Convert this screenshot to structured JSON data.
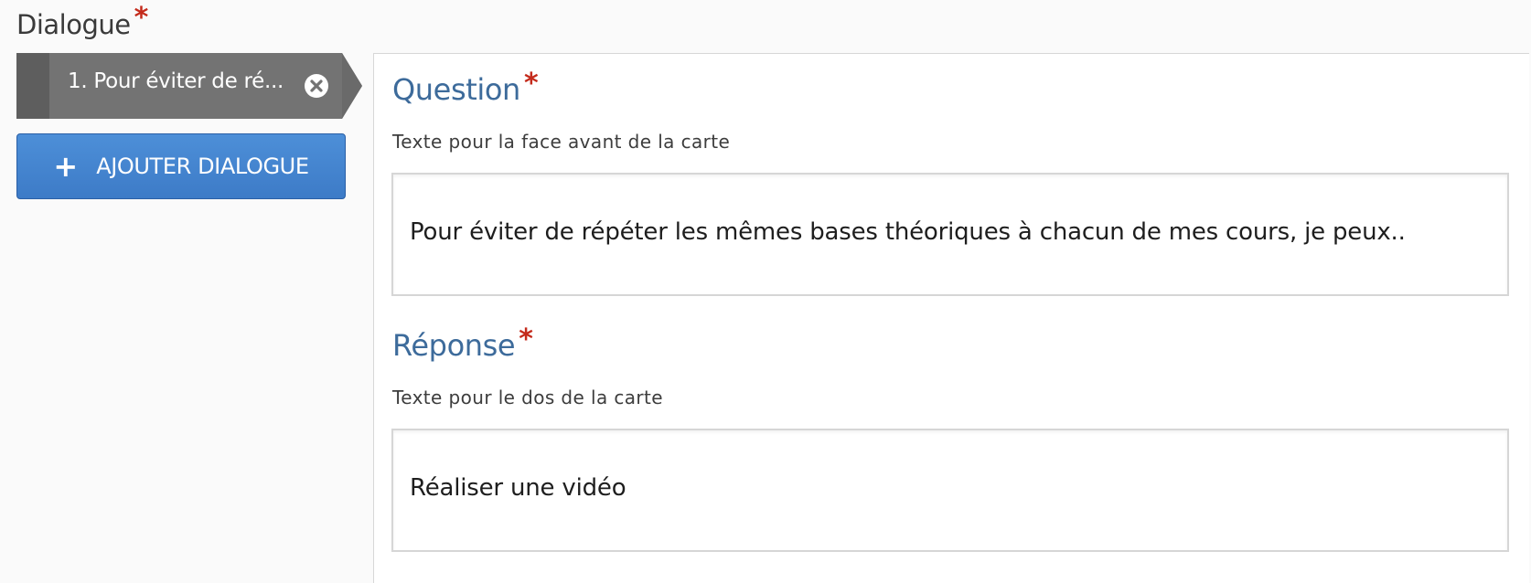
{
  "section": {
    "label": "Dialogue",
    "required_mark": "*"
  },
  "dialogue_list": {
    "items": [
      {
        "label": "1. Pour éviter de ré..."
      }
    ],
    "add_button_label": "AJOUTER DIALOGUE"
  },
  "question": {
    "title": "Question",
    "required_mark": "*",
    "description": "Texte pour la face avant de la carte",
    "value": "Pour éviter de répéter les mêmes bases théoriques à chacun de mes cours, je peux.."
  },
  "answer": {
    "title": "Réponse",
    "required_mark": "*",
    "description": "Texte pour le dos de la carte",
    "value": "Réaliser une vidéo"
  },
  "icons": {
    "tab_close": "close-circle-icon",
    "add": "plus-icon"
  },
  "colors": {
    "tab_bg": "#737373",
    "tab_handle": "#5e5e5e",
    "button_blue": "#3d7bc7",
    "title_blue": "#3d6b9b",
    "required_red": "#c42b1c"
  }
}
